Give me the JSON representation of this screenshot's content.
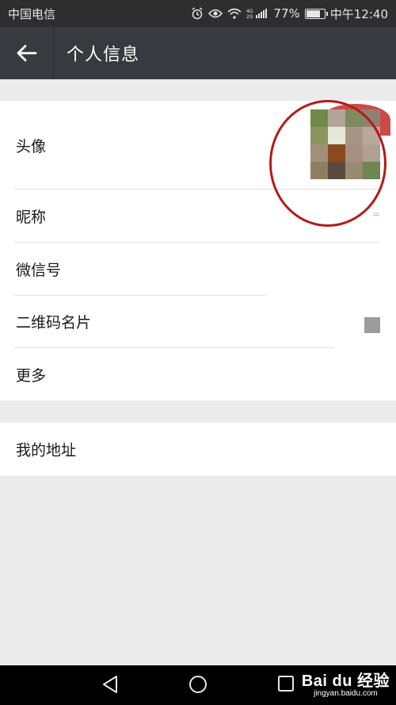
{
  "status_bar": {
    "carrier": "中国电信",
    "battery": "77%",
    "time": "中午12:40"
  },
  "header": {
    "title": "个人信息",
    "back_icon": "arrow-left-icon"
  },
  "profile_rows": [
    {
      "label": "头像"
    },
    {
      "label": "昵称"
    },
    {
      "label": "微信号"
    },
    {
      "label": "二维码名片"
    },
    {
      "label": "更多"
    }
  ],
  "address_row": {
    "label": "我的地址"
  },
  "avatar_colors": [
    "#6f8a4a",
    "#b3a49a",
    "#7f8a5e",
    "#8f8270",
    "#8a9560",
    "#e6e8d8",
    "#a99586",
    "#b9a89c",
    "#a38d7b",
    "#8a4a1f",
    "#a89080",
    "#b0a090",
    "#8d8062",
    "#5c4a3e",
    "#9a8a72",
    "#6f8650"
  ],
  "nickname_mark": "=",
  "watermark": {
    "brand": "Bai du 经验",
    "url": "jingyan.baidu.com"
  },
  "colors": {
    "title_bar": "#393a3f",
    "status_bar": "#2e2e2e",
    "highlight_circle": "#b31b1b"
  }
}
